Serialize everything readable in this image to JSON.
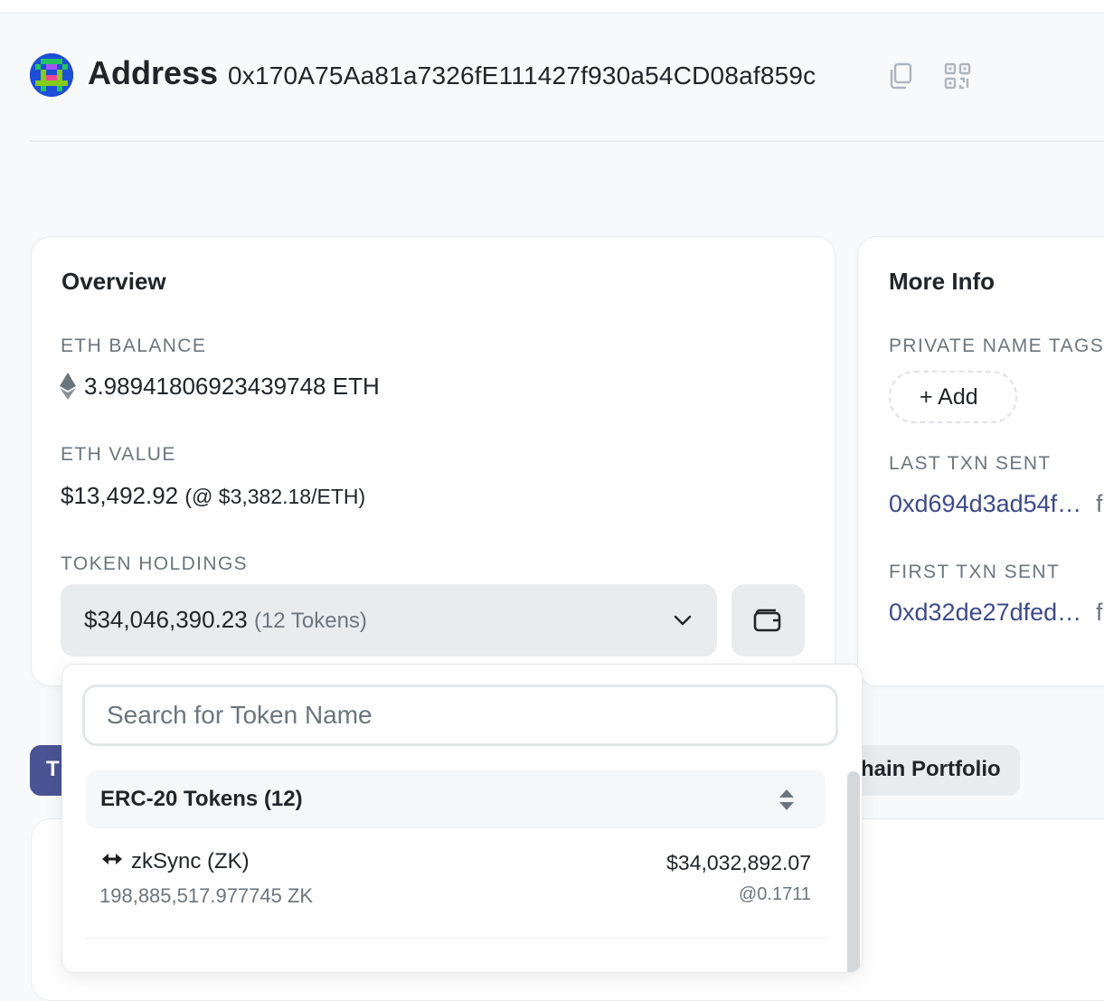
{
  "header": {
    "title": "Address",
    "address": "0x170A75Aa81a7326fE111427f930a54CD08af859c",
    "copy_icon": "copy-icon",
    "qr_icon": "qr-code-icon"
  },
  "overview": {
    "title": "Overview",
    "eth_balance_label": "ETH BALANCE",
    "eth_balance_value": "3.98941806923439748 ETH",
    "eth_value_label": "ETH VALUE",
    "eth_value": "$13,492.92",
    "eth_price": "(@ $3,382.18/ETH)",
    "token_holdings_label": "TOKEN HOLDINGS",
    "token_holdings_value": "$34,046,390.23",
    "token_holdings_count": "(12 Tokens)"
  },
  "more_info": {
    "title": "More Info",
    "private_tags_label": "PRIVATE NAME TAGS",
    "add_label": "+ Add",
    "last_txn_label": "LAST TXN SENT",
    "last_txn_hash": "0xd694d3ad54f…",
    "last_txn_suffix": "f",
    "first_txn_label": "FIRST TXN SENT",
    "first_txn_hash": "0xd32de27dfed…",
    "first_txn_suffix": "f"
  },
  "tabs": {
    "active_partial": "T",
    "portfolio_partial": "hain Portfolio"
  },
  "dropdown": {
    "search_placeholder": "Search for Token Name",
    "group_title": "ERC-20 Tokens (12)",
    "tokens": [
      {
        "name": "zkSync (ZK)",
        "amount": "198,885,517.977745 ZK",
        "usd_value": "$34,032,892.07",
        "price": "@0.1711"
      }
    ]
  },
  "colors": {
    "accent": "#4a5494",
    "link": "#3d4a8a",
    "muted": "#6c757d"
  }
}
